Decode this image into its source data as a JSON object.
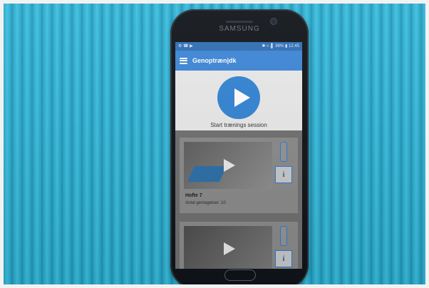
{
  "device": {
    "brand": "SAMSUNG"
  },
  "status_bar": {
    "left": "⚙ ☎ ▶",
    "right": "✱ ▿ .▌ 98% ▮ 12.45"
  },
  "app_bar": {
    "title": "Genoptræn|dk",
    "menu_icon": "hamburger-menu"
  },
  "start_session": {
    "label": "Start trænings session"
  },
  "exercises": [
    {
      "title": "Hofte 7",
      "subtitle": "Antal gentagelser: 10"
    }
  ],
  "colors": {
    "brand_blue": "#3d86d6",
    "play_blue": "#3383d3",
    "background_cyan": "#2aa7c9"
  }
}
